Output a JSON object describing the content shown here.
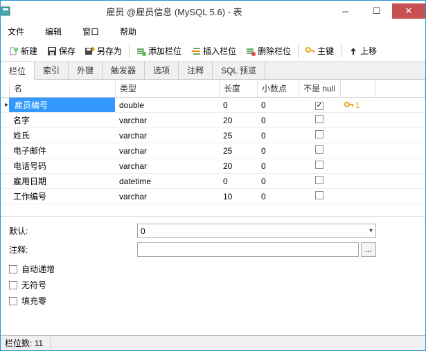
{
  "window": {
    "title": "雇员 @雇员信息 (MySQL 5.6) - 表"
  },
  "menu": {
    "file": "文件",
    "edit": "编辑",
    "window": "窗口",
    "help": "帮助"
  },
  "toolbar": {
    "new": "新建",
    "save": "保存",
    "saveas": "另存为",
    "addfield": "添加栏位",
    "insertfield": "插入栏位",
    "deletefield": "删除栏位",
    "primarykey": "主键",
    "moveup": "上移"
  },
  "tabs": {
    "fields": "栏位",
    "indexes": "索引",
    "foreignkeys": "外键",
    "triggers": "触发器",
    "options": "选项",
    "comment": "注释",
    "sqlpreview": "SQL 预览"
  },
  "gridHeader": {
    "name": "名",
    "type": "类型",
    "length": "长度",
    "decimals": "小数点",
    "notnull": "不是 null"
  },
  "rows": [
    {
      "name": "雇员编号",
      "type": "double",
      "length": "0",
      "decimals": "0",
      "notnull": true,
      "pkey": "1",
      "selected": true
    },
    {
      "name": "名字",
      "type": "varchar",
      "length": "20",
      "decimals": "0",
      "notnull": false
    },
    {
      "name": "姓氏",
      "type": "varchar",
      "length": "25",
      "decimals": "0",
      "notnull": false
    },
    {
      "name": "电子邮件",
      "type": "varchar",
      "length": "25",
      "decimals": "0",
      "notnull": false
    },
    {
      "name": "电话号码",
      "type": "varchar",
      "length": "20",
      "decimals": "0",
      "notnull": false
    },
    {
      "name": "雇用日期",
      "type": "datetime",
      "length": "0",
      "decimals": "0",
      "notnull": false
    },
    {
      "name": "工作编号",
      "type": "varchar",
      "length": "10",
      "decimals": "0",
      "notnull": false
    }
  ],
  "props": {
    "defaultLabel": "默认:",
    "defaultValue": "0",
    "commentLabel": "注释:",
    "commentValue": "",
    "autoInc": "自动递增",
    "unsigned": "无符号",
    "zerofill": "填充零",
    "ellipsis": "..."
  },
  "status": {
    "fieldcount_label": "栏位数:",
    "fieldcount_value": "11"
  }
}
